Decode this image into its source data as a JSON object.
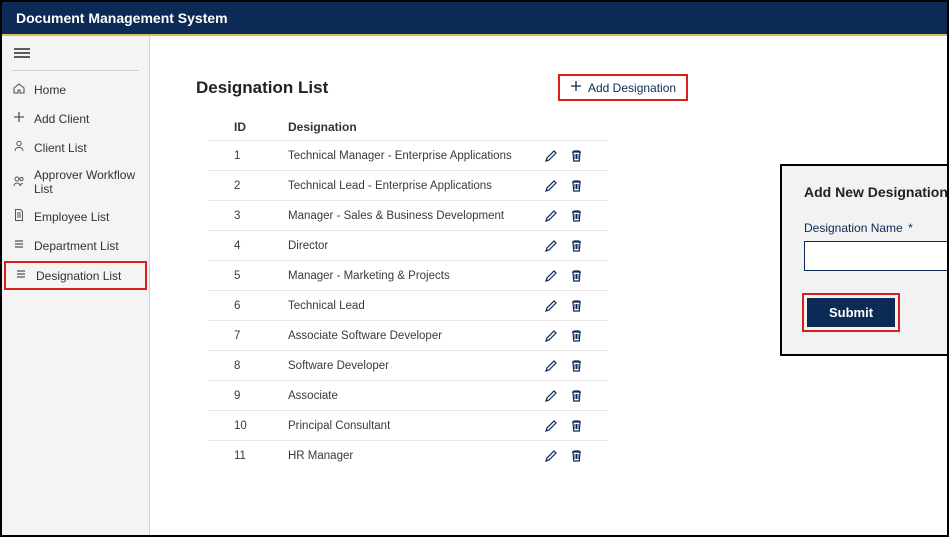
{
  "header": {
    "title": "Document Management System"
  },
  "sidebar": {
    "items": [
      {
        "label": "Home",
        "icon": "home"
      },
      {
        "label": "Add Client",
        "icon": "plus"
      },
      {
        "label": "Client List",
        "icon": "person"
      },
      {
        "label": "Approver Workflow List",
        "icon": "people"
      },
      {
        "label": "Employee List",
        "icon": "doc"
      },
      {
        "label": "Department List",
        "icon": "list"
      },
      {
        "label": "Designation List",
        "icon": "list"
      }
    ],
    "activeIndex": 6
  },
  "page": {
    "title": "Designation List",
    "add_label": "Add Designation",
    "columns": {
      "id": "ID",
      "name": "Designation"
    },
    "rows": [
      {
        "id": "1",
        "name": "Technical Manager - Enterprise Applications"
      },
      {
        "id": "2",
        "name": "Technical Lead - Enterprise Applications"
      },
      {
        "id": "3",
        "name": "Manager - Sales & Business Development"
      },
      {
        "id": "4",
        "name": "Director"
      },
      {
        "id": "5",
        "name": "Manager - Marketing & Projects"
      },
      {
        "id": "6",
        "name": "Technical Lead"
      },
      {
        "id": "7",
        "name": "Associate Software Developer"
      },
      {
        "id": "8",
        "name": "Software Developer"
      },
      {
        "id": "9",
        "name": "Associate"
      },
      {
        "id": "10",
        "name": "Principal Consultant"
      },
      {
        "id": "11",
        "name": "HR Manager"
      }
    ]
  },
  "modal": {
    "title": "Add New Designation",
    "field_label": "Designation Name",
    "required_mark": "*",
    "value": "",
    "submit": "Submit"
  },
  "colors": {
    "brand": "#0b2a55",
    "highlight": "#d81e1e",
    "accentGold": "#d7c25a"
  }
}
